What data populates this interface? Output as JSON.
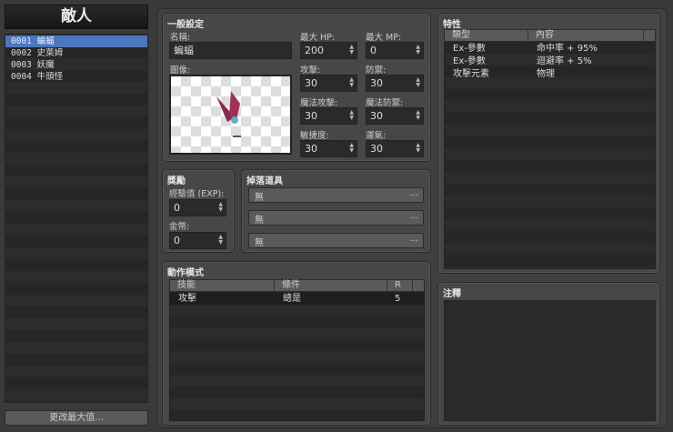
{
  "left": {
    "title": "敵人",
    "items": [
      {
        "id": "0001",
        "name": "蝙蝠"
      },
      {
        "id": "0002",
        "name": "史萊姆"
      },
      {
        "id": "0003",
        "name": "妖魔"
      },
      {
        "id": "0004",
        "name": "牛頭怪"
      }
    ],
    "change_max": "更改最大值..."
  },
  "general": {
    "title": "一般設定",
    "name_label": "名稱:",
    "name": "蝙蝠",
    "image_label": "圖像:",
    "stats": [
      {
        "label": "最大 HP:",
        "value": "200"
      },
      {
        "label": "最大 MP:",
        "value": "0"
      },
      {
        "label": "攻擊:",
        "value": "30"
      },
      {
        "label": "防禦:",
        "value": "30"
      },
      {
        "label": "魔法攻擊:",
        "value": "30"
      },
      {
        "label": "魔法防禦:",
        "value": "30"
      },
      {
        "label": "敏捷度:",
        "value": "30"
      },
      {
        "label": "運氣:",
        "value": "30"
      }
    ]
  },
  "rewards": {
    "title": "獎勵",
    "exp_label": "經驗值 (EXP):",
    "exp": "0",
    "gold_label": "金幣:",
    "gold": "0"
  },
  "drops": {
    "title": "掉落道具",
    "items": [
      "無",
      "無",
      "無"
    ],
    "more": "..."
  },
  "actions": {
    "title": "動作模式",
    "columns": [
      "技能",
      "條件",
      "R"
    ],
    "rows": [
      {
        "skill": "攻擊",
        "condition": "總是",
        "rating": "5"
      }
    ]
  },
  "traits": {
    "title": "特性",
    "columns": [
      "類型",
      "內容"
    ],
    "rows": [
      {
        "type": "Ex-參數",
        "content": "命中率 + 95%"
      },
      {
        "type": "Ex-參數",
        "content": "迴避率 + 5%"
      },
      {
        "type": "攻擊元素",
        "content": "物理"
      }
    ]
  },
  "notes": {
    "title": "注釋"
  }
}
